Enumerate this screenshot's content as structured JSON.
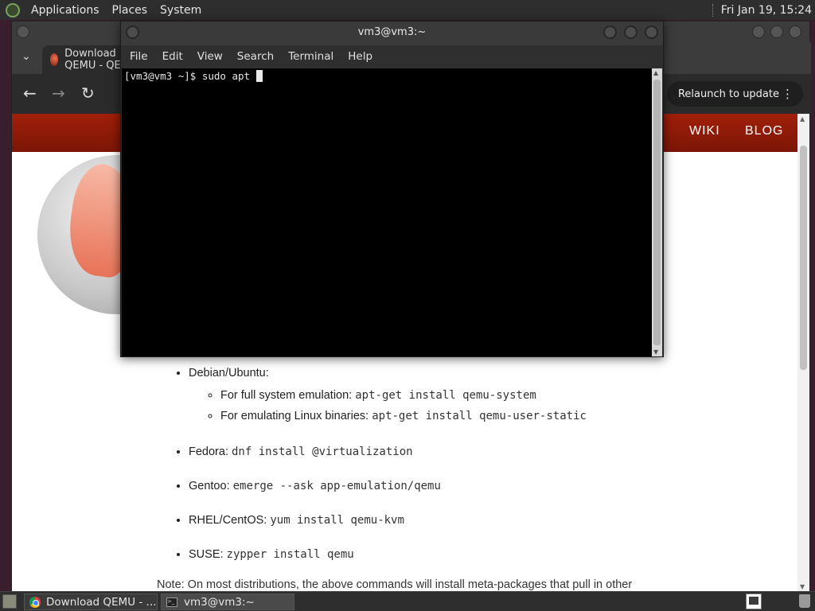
{
  "top_panel": {
    "applications": "Applications",
    "places": "Places",
    "system": "System",
    "clock": "Fri Jan 19, 15:24"
  },
  "browser": {
    "tab_title": "Download QEMU - QEMU",
    "relaunch_label": "Relaunch to update",
    "nav_links": [
      "WIKI",
      "BLOG"
    ],
    "content": {
      "debian": {
        "label": "Debian/Ubuntu:",
        "items": [
          {
            "text": "For full system emulation: ",
            "code": "apt-get install qemu-system"
          },
          {
            "text": "For emulating Linux binaries: ",
            "code": "apt-get install qemu-user-static"
          }
        ]
      },
      "fedora": {
        "label": "Fedora: ",
        "code": "dnf install @virtualization"
      },
      "gentoo": {
        "label": "Gentoo: ",
        "code": "emerge --ask app-emulation/qemu"
      },
      "rhel": {
        "label": "RHEL/CentOS: ",
        "code": "yum install qemu-kvm"
      },
      "suse": {
        "label": "SUSE: ",
        "code": "zypper install qemu"
      },
      "note": "Note: On most distributions, the above commands will install meta-packages that pull in other"
    }
  },
  "terminal": {
    "title": "vm3@vm3:~",
    "menu": [
      "File",
      "Edit",
      "View",
      "Search",
      "Terminal",
      "Help"
    ],
    "prompt": "[vm3@vm3 ~]$ ",
    "command": "sudo apt "
  },
  "taskbar": {
    "tasks": [
      {
        "label": "Download QEMU - ..."
      },
      {
        "label": "vm3@vm3:~"
      }
    ]
  }
}
